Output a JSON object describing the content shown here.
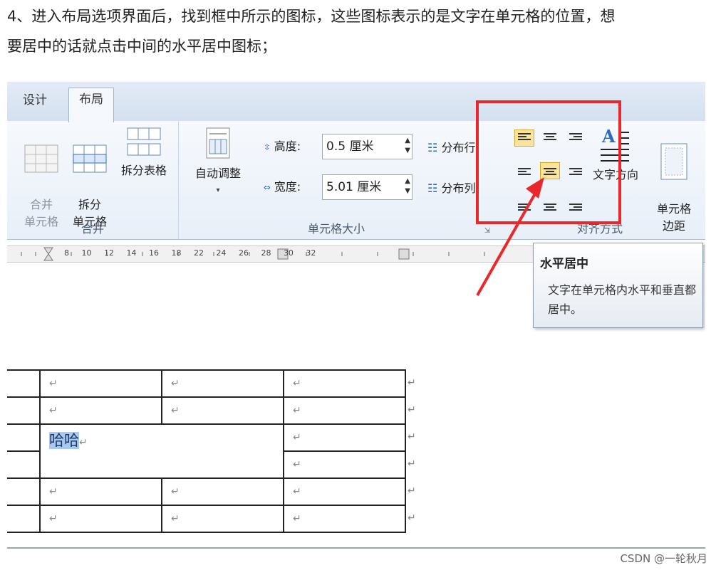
{
  "intro": {
    "line1": "4、进入布局选项界面后，找到框中所示的图标，这些图标表示的是文字在单元格的位置，想",
    "line2": "要居中的话就点击中间的水平居中图标；"
  },
  "tabs": [
    {
      "label": "设计"
    },
    {
      "label": "布局",
      "selected": true
    }
  ],
  "ribbon": {
    "merge_group": {
      "label": "合并",
      "merge_cells": "合并\n单元格",
      "split_cells": "拆分\n单元格",
      "split_table": "拆分表格"
    },
    "cellsize_group": {
      "label": "单元格大小",
      "autofit": "自动调整",
      "height_label": "高度:",
      "height_value": "0.5 厘米",
      "width_label": "宽度:",
      "width_value": "5.01 厘米",
      "distribute_rows": "分布行",
      "distribute_cols": "分布列"
    },
    "align_group": {
      "label": "对齐方式",
      "text_direction": "文字方向",
      "cell_margins": "单元格\n边距"
    }
  },
  "ruler": {
    "ticks": "8   10   12   14   16   18          22   24   26   28   30   32"
  },
  "tooltip": {
    "title": "水平居中",
    "body": "文字在单元格内水平和垂直都居中。"
  },
  "doc": {
    "selected_text": "哈哈",
    "para_mark": "↵"
  },
  "watermark": "CSDN @一轮秋月",
  "colors": {
    "highlight_frame": "#e8282a",
    "active_align": "#fbe49a",
    "arrow": "#e8282a"
  }
}
